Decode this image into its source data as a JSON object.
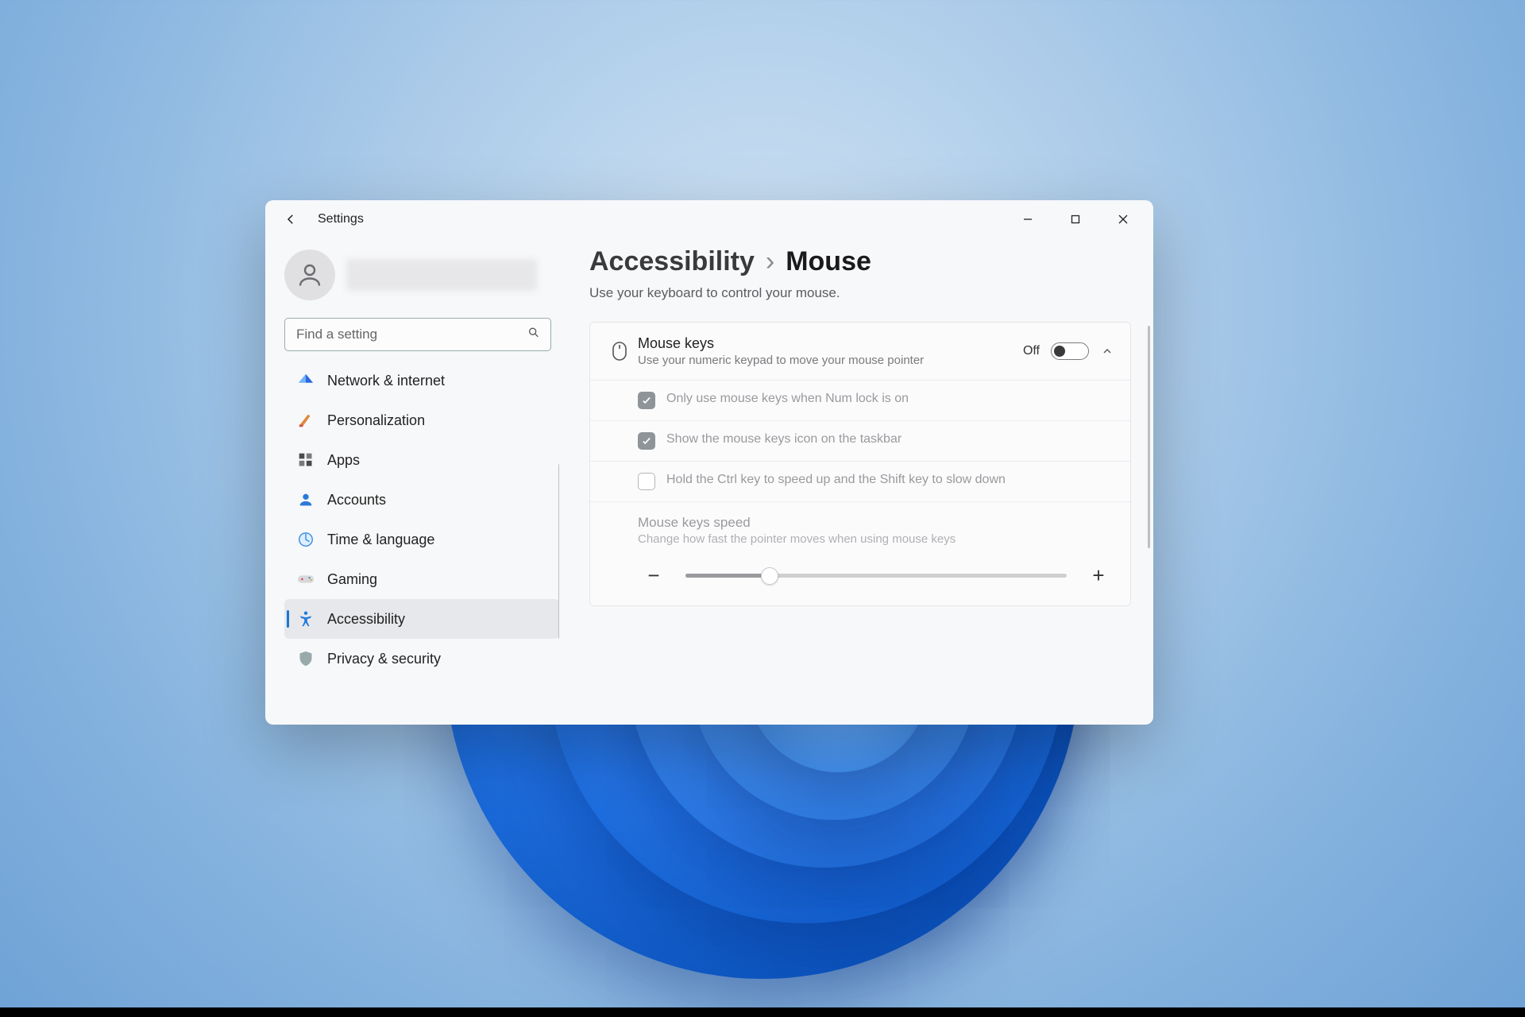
{
  "window": {
    "title": "Settings"
  },
  "search": {
    "placeholder": "Find a setting"
  },
  "sidebar": {
    "items": [
      {
        "label": "Network & internet"
      },
      {
        "label": "Personalization"
      },
      {
        "label": "Apps"
      },
      {
        "label": "Accounts"
      },
      {
        "label": "Time & language"
      },
      {
        "label": "Gaming"
      },
      {
        "label": "Accessibility"
      },
      {
        "label": "Privacy & security"
      }
    ],
    "active_index": 6
  },
  "breadcrumb": {
    "parent": "Accessibility",
    "separator": "›",
    "leaf": "Mouse"
  },
  "page": {
    "subhead": "Use your keyboard to control your mouse."
  },
  "mouse_keys": {
    "title": "Mouse keys",
    "desc": "Use your numeric keypad to move your mouse pointer",
    "state_label": "Off",
    "options": {
      "numlock": "Only use mouse keys when Num lock is on",
      "taskbar_icon": "Show the mouse keys icon on the taskbar",
      "ctrl_shift": "Hold the Ctrl key to speed up and the Shift key to slow down"
    },
    "speed": {
      "title": "Mouse keys speed",
      "desc": "Change how fast the pointer moves when using mouse keys",
      "minus": "−",
      "plus": "+"
    }
  }
}
